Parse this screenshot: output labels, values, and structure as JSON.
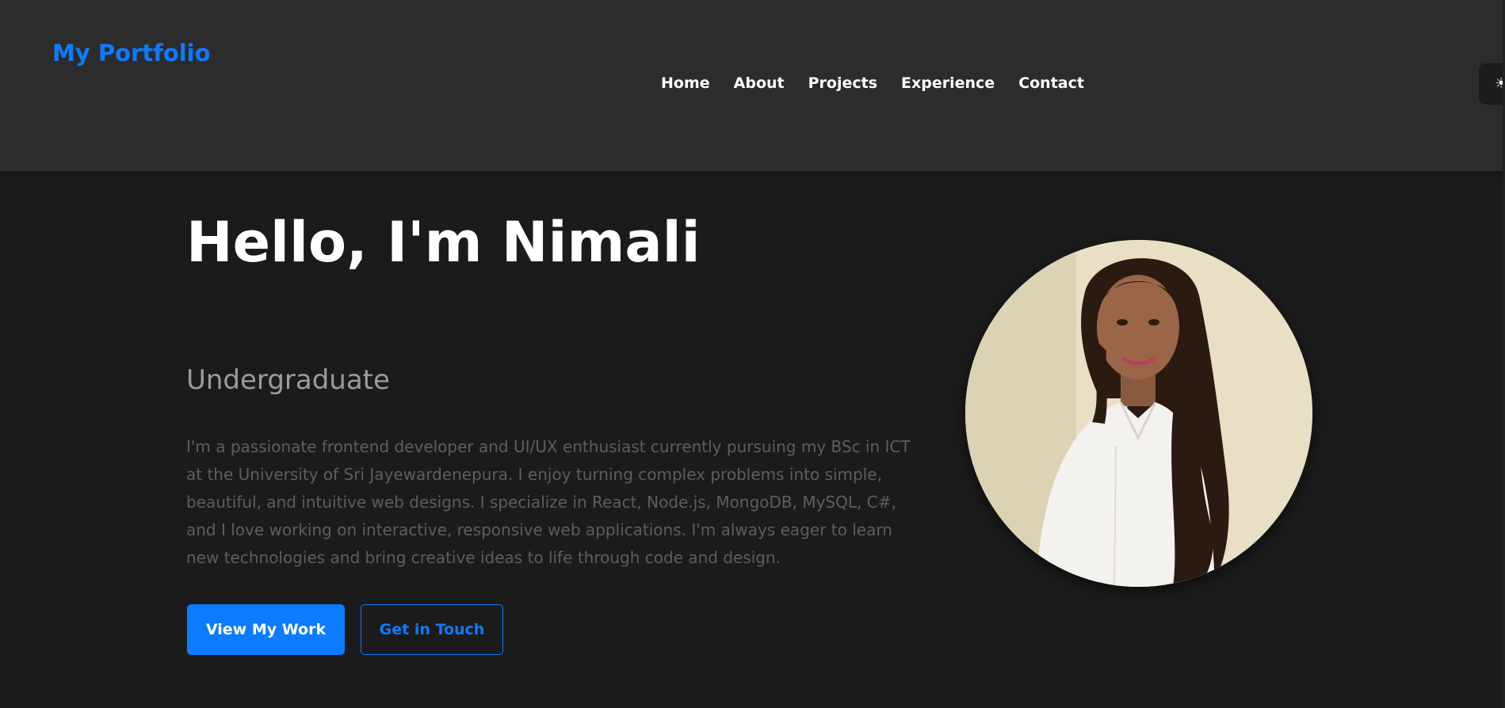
{
  "header": {
    "brand": "My Portfolio",
    "nav": [
      {
        "label": "Home"
      },
      {
        "label": "About"
      },
      {
        "label": "Projects"
      },
      {
        "label": "Experience"
      },
      {
        "label": "Contact"
      }
    ],
    "theme_toggle_icon": "sun-icon"
  },
  "hero": {
    "greeting": "Hello, I'm Nimali",
    "subtitle": "Undergraduate",
    "description": "I'm a passionate frontend developer and UI/UX enthusiast currently pursuing my BSc in ICT at the University of Sri Jayewardenepura. I enjoy turning complex problems into simple, beautiful, and intuitive web designs. I specialize in React, Node.js, MongoDB, MySQL, C#, and I love working on interactive, responsive web applications. I'm always eager to learn new technologies and bring creative ideas to life through code and design.",
    "primary_button": "View My Work",
    "secondary_button": "Get in Touch",
    "avatar_alt_icon": "profile-photo"
  },
  "colors": {
    "accent": "#0d7bff",
    "background": "#1b1b1b",
    "navbar": "#2c2c2c",
    "heading": "#ffffff",
    "subtitle": "#9b9b9b",
    "body_text": "#5e5e5e"
  }
}
